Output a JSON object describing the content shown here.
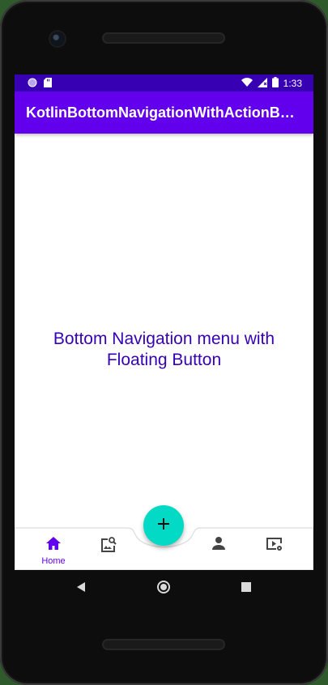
{
  "status_bar": {
    "time": "1:33"
  },
  "app_bar": {
    "title": "KotlinBottomNavigationWithActionButton"
  },
  "content": {
    "message_line1": "Bottom Navigation menu with",
    "message_line2": "Floating Button"
  },
  "bottom_nav": {
    "items": [
      {
        "label": "Home",
        "icon": "home-icon",
        "selected": true
      },
      {
        "label": "",
        "icon": "image-search-icon",
        "selected": false
      },
      {
        "label": "",
        "icon": "person-icon",
        "selected": false
      },
      {
        "label": "",
        "icon": "video-settings-icon",
        "selected": false
      }
    ]
  },
  "fab": {
    "icon": "add-icon"
  },
  "colors": {
    "primary": "#6200ee",
    "primary_dark": "#3700b3",
    "secondary": "#03dac5"
  }
}
